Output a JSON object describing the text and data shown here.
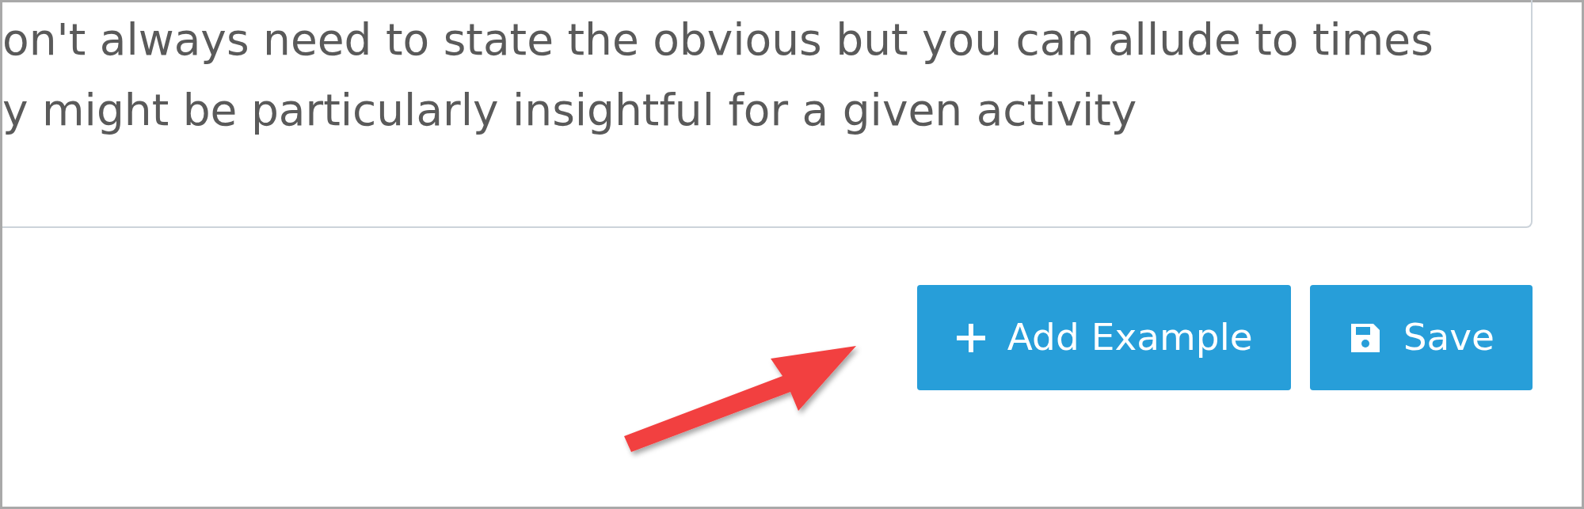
{
  "text_field": {
    "value": "on't always need to state the obvious but you can allude to times\ny might be particularly insightful for a given activity"
  },
  "buttons": [
    {
      "label": "Add Example",
      "kind": "add"
    },
    {
      "label": "Save",
      "kind": "save"
    }
  ]
}
